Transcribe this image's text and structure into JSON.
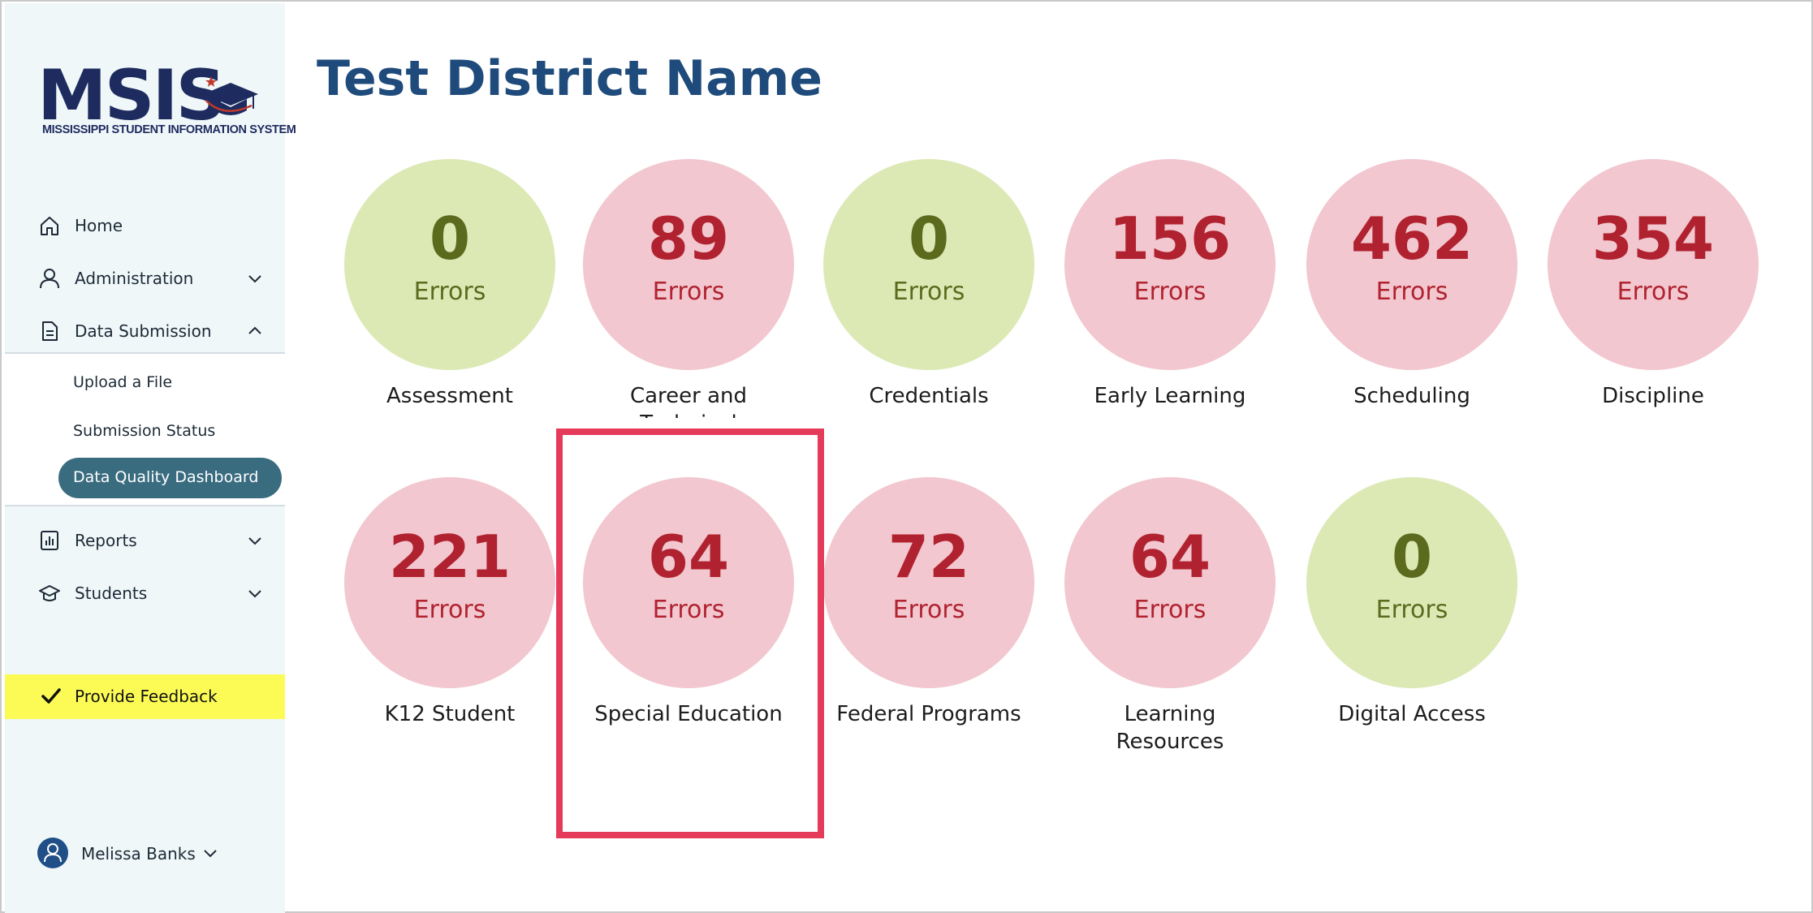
{
  "app": {
    "logo_text": "MSIS",
    "logo_subtitle": "MISSISSIPPI STUDENT INFORMATION SYSTEM"
  },
  "sidebar": {
    "nav": [
      {
        "label": "Home",
        "icon": "home-icon"
      },
      {
        "label": "Administration",
        "icon": "user-icon",
        "expanded": false
      },
      {
        "label": "Data Submission",
        "icon": "document-icon",
        "expanded": true
      },
      {
        "label": "Reports",
        "icon": "bar-chart-icon",
        "expanded": false
      },
      {
        "label": "Students",
        "icon": "graduation-cap-icon",
        "expanded": false
      }
    ],
    "data_submission_items": [
      {
        "label": "Upload a File"
      },
      {
        "label": "Submission Status"
      },
      {
        "label": "Data Quality Dashboard",
        "active": true
      }
    ],
    "feedback_label": "Provide Feedback",
    "user_name": "Melissa Banks"
  },
  "main": {
    "title": "Test District Name",
    "error_unit": "Errors",
    "cards": [
      {
        "label": "Assessment",
        "count": "0",
        "status": "ok"
      },
      {
        "label": "Career and Technical",
        "count": "89",
        "status": "error"
      },
      {
        "label": "Credentials",
        "count": "0",
        "status": "ok"
      },
      {
        "label": "Early Learning",
        "count": "156",
        "status": "error"
      },
      {
        "label": "Scheduling",
        "count": "462",
        "status": "error"
      },
      {
        "label": "Discipline",
        "count": "354",
        "status": "error"
      },
      {
        "label": "K12 Student",
        "count": "221",
        "status": "error"
      },
      {
        "label": "Special Education",
        "count": "64",
        "status": "error",
        "highlighted": true
      },
      {
        "label": "Federal Programs",
        "count": "72",
        "status": "error"
      },
      {
        "label": "Learning Resources",
        "count": "64",
        "status": "error"
      },
      {
        "label": "Digital Access",
        "count": "0",
        "status": "ok"
      }
    ]
  },
  "colors": {
    "ok_circle": "#dce9b5",
    "error_circle": "#f2c7cf",
    "ok_text": "#5c6a1e",
    "error_text": "#b0222f",
    "title": "#1e4b7b",
    "active_pill": "#3a6c80",
    "feedback_bg": "#fcfb56",
    "highlight_border": "#e63a5a"
  }
}
